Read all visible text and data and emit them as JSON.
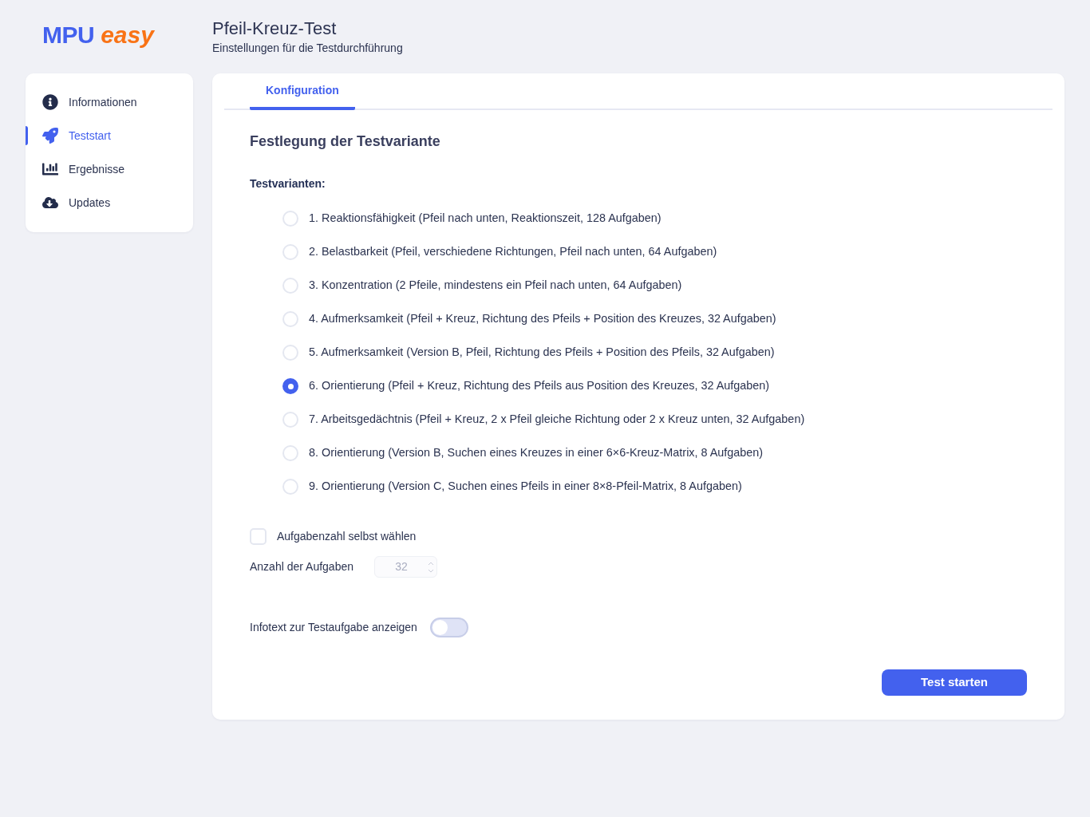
{
  "logo": {
    "primary": "MPU",
    "accent": "easy"
  },
  "header": {
    "title": "Pfeil-Kreuz-Test",
    "subtitle": "Einstellungen für die Testdurchführung"
  },
  "sidebar": {
    "items": [
      {
        "label": "Informationen",
        "selected": false
      },
      {
        "label": "Teststart",
        "selected": true
      },
      {
        "label": "Ergebnisse",
        "selected": false
      },
      {
        "label": "Updates",
        "selected": false
      }
    ]
  },
  "tabs": [
    {
      "label": "Konfiguration",
      "selected": true
    }
  ],
  "section": {
    "title": "Festlegung der Testvariante",
    "variants_label": "Testvarianten:"
  },
  "variants": [
    {
      "label": "1. Reaktionsfähigkeit (Pfeil nach unten, Reaktionszeit, 128 Aufgaben)",
      "selected": false
    },
    {
      "label": "2. Belastbarkeit (Pfeil, verschiedene Richtungen, Pfeil nach unten, 64 Aufgaben)",
      "selected": false
    },
    {
      "label": "3. Konzentration (2 Pfeile, mindestens ein Pfeil nach unten, 64 Aufgaben)",
      "selected": false
    },
    {
      "label": "4. Aufmerksamkeit (Pfeil + Kreuz, Richtung des Pfeils + Position des Kreuzes, 32 Aufgaben)",
      "selected": false
    },
    {
      "label": "5. Aufmerksamkeit (Version B, Pfeil, Richtung des Pfeils + Position des Pfeils, 32 Aufgaben)",
      "selected": false
    },
    {
      "label": "6. Orientierung (Pfeil + Kreuz, Richtung des Pfeils aus Position des Kreuzes, 32 Aufgaben)",
      "selected": true
    },
    {
      "label": "7. Arbeitsgedächtnis (Pfeil + Kreuz, 2 x Pfeil gleiche Richtung oder 2 x Kreuz unten, 32 Aufgaben)",
      "selected": false
    },
    {
      "label": "8. Orientierung (Version B, Suchen eines Kreuzes in einer 6×6-Kreuz-Matrix, 8 Aufgaben)",
      "selected": false
    },
    {
      "label": "9. Orientierung (Version C, Suchen eines Pfeils in einer 8×8-Pfeil-Matrix, 8 Aufgaben)",
      "selected": false
    }
  ],
  "custom_count": {
    "label": "Aufgabenzahl selbst wählen",
    "checked": false
  },
  "task_count": {
    "label": "Anzahl der Aufgaben",
    "value": "32",
    "disabled": true
  },
  "infotext": {
    "label": "Infotext zur Testaufgabe anzeigen",
    "on": false
  },
  "start_button": {
    "label": "Test starten"
  }
}
